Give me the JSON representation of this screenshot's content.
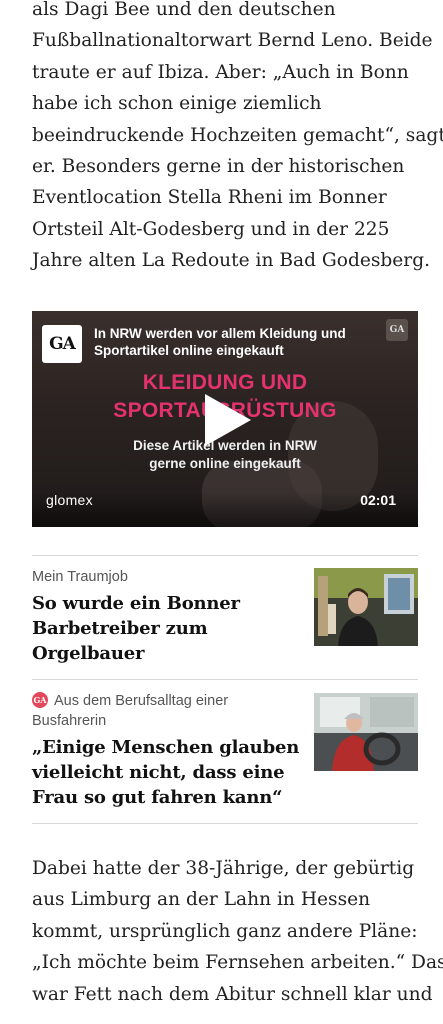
{
  "article": {
    "paragraph_1": [
      "als Dagi Bee und den deutschen",
      "Fußballnationaltorwart Bernd Leno. Beide",
      "traute er auf Ibiza. Aber: „Auch in Bonn",
      "habe ich schon einige ziemlich",
      "beeindruckende Hochzeiten gemacht“, sagt",
      "er. Besonders gerne in der historischen",
      "Eventlocation Stella Rheni im Bonner",
      "Ortsteil Alt-Godesberg und in der 225",
      "Jahre alten La Redoute in Bad Godesberg."
    ],
    "paragraph_2": [
      "Dabei hatte der 38-Jährige, der gebürtig",
      "aus Limburg an der Lahn in Hessen",
      "kommt, ursprünglich ganz andere Pläne:",
      "„Ich möchte beim Fernsehen arbeiten.“ Das",
      "war Fett nach dem Abitur schnell klar und"
    ]
  },
  "video": {
    "logo_text": "GA",
    "small_logo_text": "GA",
    "title_lines": [
      "In NRW werden vor allem Kleidung und",
      "Sportartikel online eingekauft"
    ],
    "headline_lines": [
      "KLEIDUNG UND",
      "SPORTAUSRÜSTUNG"
    ],
    "sub_lines": [
      "Diese Artikel werden in NRW",
      "gerne online eingekauft"
    ],
    "brand": "glomex",
    "duration": "02:01",
    "play_icon": "play-icon",
    "accent_color": "#e4326f"
  },
  "teasers": [
    {
      "kicker_lines": [
        "Mein Traumjob"
      ],
      "headline_lines": [
        "So wurde ein Bonner",
        "Barbetreiber zum",
        "Orgelbauer"
      ],
      "premium": false
    },
    {
      "kicker_lines": [
        "Aus dem Berufsalltag einer",
        "Busfahrerin"
      ],
      "headline_lines": [
        "„Einige Menschen glauben",
        "vielleicht nicht, dass eine",
        "Frau so gut fahren kann“"
      ],
      "premium": true,
      "premium_badge_text": "GA",
      "premium_color": "#e4475a"
    }
  ]
}
